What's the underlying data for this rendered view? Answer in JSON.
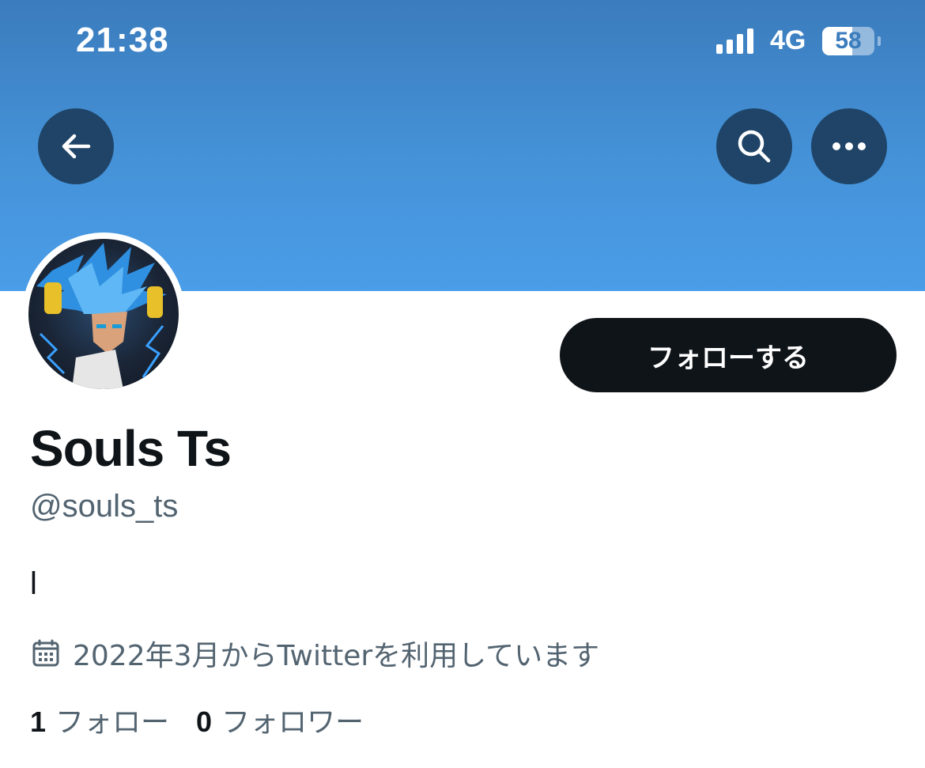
{
  "status_bar": {
    "time": "21:38",
    "network": "4G",
    "battery": "58",
    "battery_level": 0.58
  },
  "header": {
    "back_icon": "arrow-left-icon",
    "search_icon": "search-icon",
    "more_icon": "more-horizontal-icon"
  },
  "profile": {
    "display_name": "Souls Ts",
    "handle": "@souls_ts",
    "bio": "l",
    "joined": "2022年3月からTwitterを利用しています",
    "follow_button": "フォローする",
    "following_count": "1",
    "following_label": "フォロー",
    "followers_count": "0",
    "followers_label": "フォロワー"
  },
  "colors": {
    "banner_top": "#3b7cbd",
    "banner_bottom": "#4a9de8",
    "button_dark": "#0f1419",
    "circle_button": "#1f4467",
    "secondary_text": "#536471"
  }
}
